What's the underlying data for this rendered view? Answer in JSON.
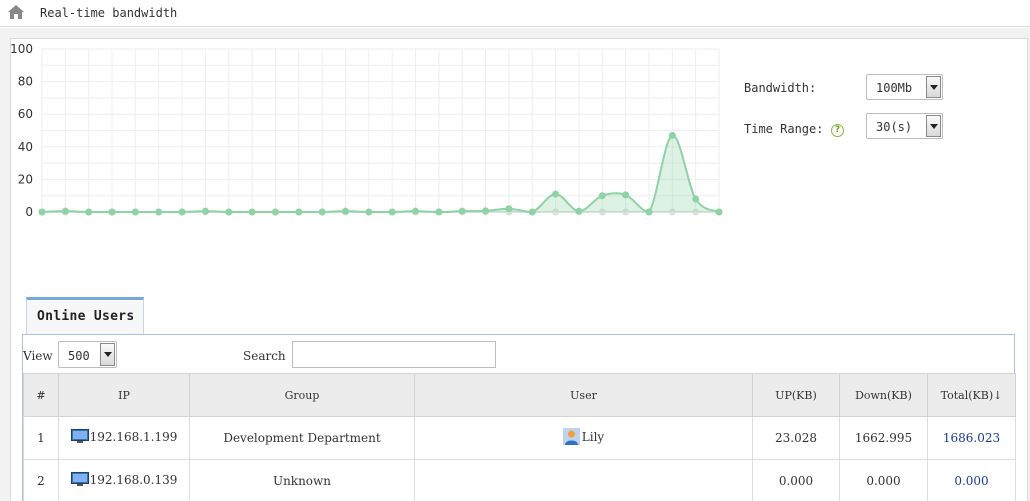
{
  "header": {
    "title": "Real-time bandwidth",
    "icon": "home-icon"
  },
  "chart_data": {
    "type": "area",
    "xlabel": "",
    "ylabel": "",
    "ylim": [
      0,
      100
    ],
    "yticks": [
      0,
      20,
      40,
      60,
      80,
      100
    ],
    "grid": true,
    "x": [
      0,
      1,
      2,
      3,
      4,
      5,
      6,
      7,
      8,
      9,
      10,
      11,
      12,
      13,
      14,
      15,
      16,
      17,
      18,
      19,
      20,
      21,
      22,
      23,
      24,
      25,
      26,
      27,
      28,
      29
    ],
    "series": [
      {
        "color": "#8fd2a6",
        "values": [
          0,
          0.5,
          0,
          0,
          0,
          0,
          0,
          0.5,
          0,
          0,
          0,
          0,
          0,
          0.5,
          0,
          0,
          0.5,
          0,
          0.5,
          0.7,
          2,
          0,
          11,
          0.5,
          10,
          10.5,
          0,
          47,
          8,
          0
        ]
      },
      {
        "color": "#d9e3dc",
        "values": [
          0,
          0,
          0,
          0,
          0,
          0,
          0,
          0,
          0,
          0,
          0,
          0,
          0,
          0,
          0,
          0,
          0,
          0,
          0,
          0,
          0,
          0,
          0,
          0,
          0,
          0,
          0,
          0,
          0,
          0
        ]
      }
    ]
  },
  "controls": {
    "bandwidth_label": "Bandwidth:",
    "bandwidth_value": "100Mb",
    "time_range_label": "Time Range:",
    "time_range_value": "30(s)",
    "help_glyph": "?"
  },
  "online_users": {
    "tab_label": "Online Users",
    "view_label": "View",
    "view_value": "500",
    "search_label": "Search",
    "search_value": "",
    "columns": [
      "#",
      "IP",
      "Group",
      "User",
      "UP(KB)",
      "Down(KB)",
      "Total(KB)"
    ],
    "sort_indicator": "↓",
    "rows": [
      {
        "num": "1",
        "ip": "192.168.1.199",
        "group": "Development Department",
        "user": "Lily",
        "up": "23.028",
        "down": "1662.995",
        "total": "1686.023"
      },
      {
        "num": "2",
        "ip": "192.168.0.139",
        "group": "Unknown",
        "user": "",
        "up": "0.000",
        "down": "0.000",
        "total": "0.000"
      }
    ]
  },
  "colors": {
    "accent": "#78a7d8",
    "line": "#8fd2a6",
    "total_text": "#1b3a9b"
  }
}
